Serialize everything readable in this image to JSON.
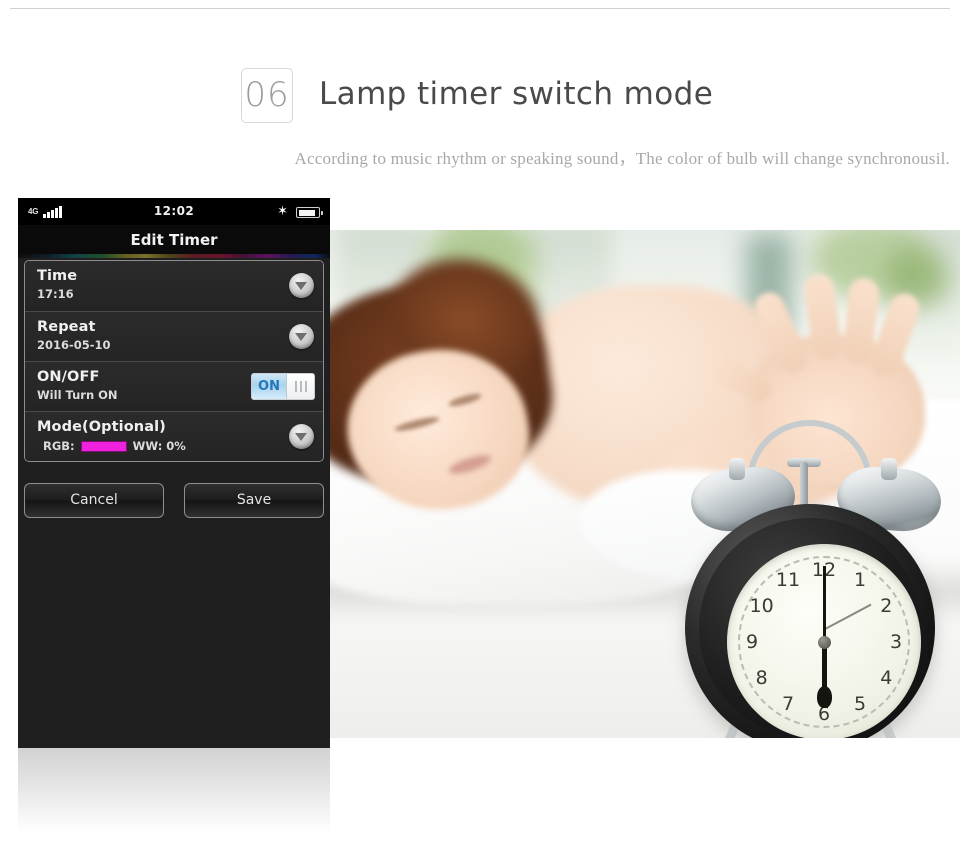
{
  "header": {
    "number": "06",
    "title": "Lamp timer switch mode",
    "subtitle": "According to music rhythm or speaking sound，The color of bulb will change synchronousil."
  },
  "phone": {
    "statusbar": {
      "network": "4G",
      "signal_icon": "signal-bars-icon",
      "time": "12:02",
      "bluetooth_icon": "bluetooth-icon",
      "battery_icon": "battery-icon"
    },
    "titlebar": {
      "title": "Edit Timer"
    },
    "rows": [
      {
        "label": "Time",
        "value": "17:16",
        "control": "chevron-down-icon"
      },
      {
        "label": "Repeat",
        "value": "2016-05-10",
        "control": "chevron-down-icon"
      },
      {
        "label": "ON/OFF",
        "value": "Will Turn ON",
        "control": "toggle-switch",
        "toggle_label": "ON",
        "toggle_state": "on"
      },
      {
        "label": "Mode(Optional)",
        "control": "chevron-down-icon",
        "rgb_label": "RGB:",
        "rgb_color": "#ef21dd",
        "ww_label": "WW: 0%"
      }
    ],
    "buttons": {
      "cancel": "Cancel",
      "save": "Save"
    }
  },
  "photo": {
    "alt": "Woman sleeping in bed reaching to switch off a twin-bell alarm clock",
    "clock": {
      "numerals": [
        "12",
        "1",
        "2",
        "3",
        "4",
        "5",
        "6",
        "7",
        "8",
        "9",
        "10",
        "11"
      ],
      "time_shown": "6:00"
    }
  },
  "colors": {
    "accent_magenta": "#ef21dd",
    "toggle_blue": "#2277bb",
    "panel_dark": "#1f1f1f",
    "text_gray": "#4a4a4a",
    "subtitle_gray": "#a8a8a8"
  }
}
